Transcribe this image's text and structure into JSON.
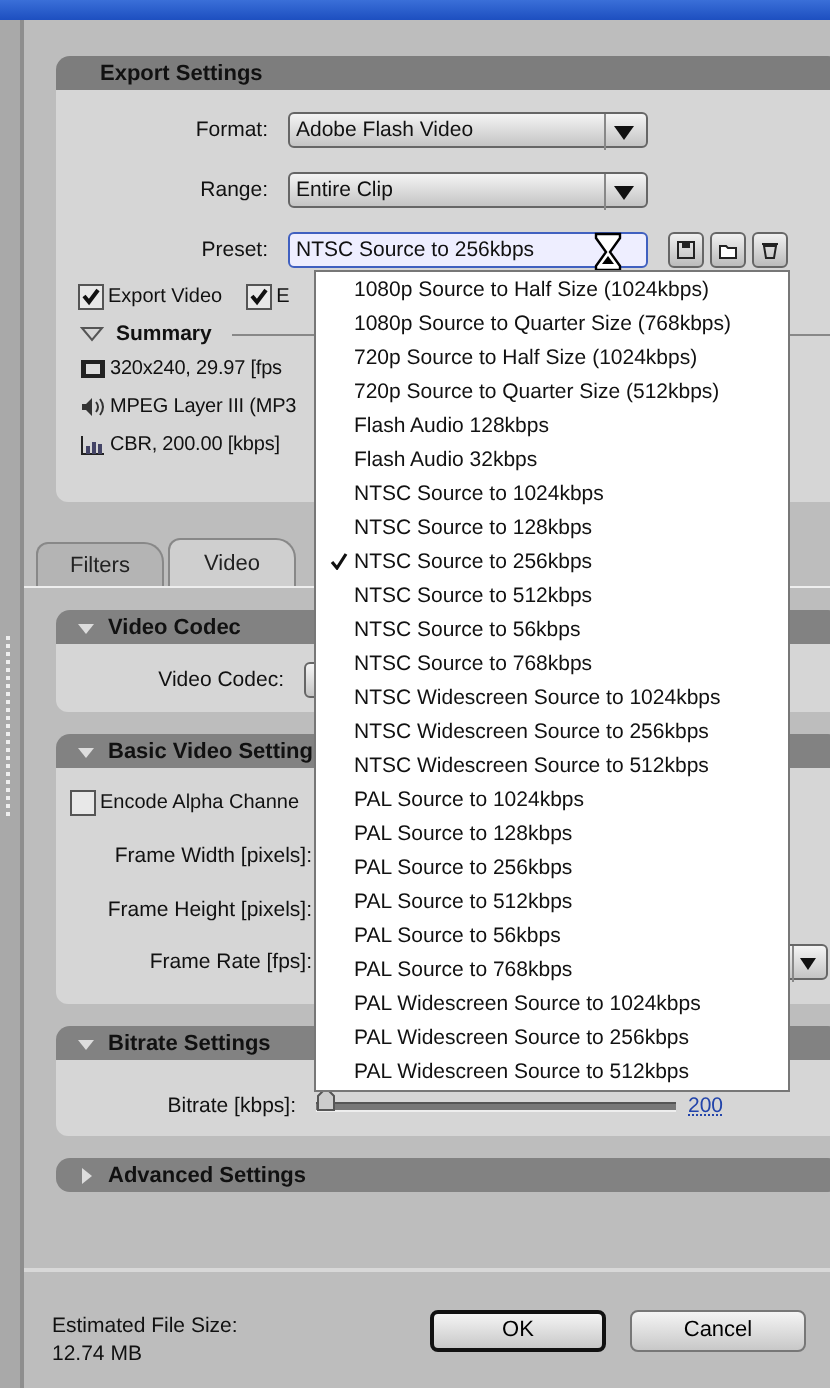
{
  "export_settings": {
    "title": "Export Settings",
    "fields": [
      {
        "label": "Format:",
        "value": "Adobe Flash Video",
        "kind": "dropdown"
      },
      {
        "label": "Range:",
        "value": "Entire Clip",
        "kind": "dropdown"
      },
      {
        "label": "Preset:",
        "value": "NTSC Source to 256kbps",
        "kind": "preset"
      }
    ],
    "checkboxes": [
      {
        "label": "Export Video",
        "checked": true
      },
      {
        "label": "E",
        "checked": true
      }
    ],
    "summary": {
      "title": "Summary",
      "expanded": true,
      "lines": [
        {
          "kind": "video",
          "text": "320x240, 29.97 [fps"
        },
        {
          "kind": "audio",
          "text": "MPEG Layer III (MP3"
        },
        {
          "kind": "bitrate",
          "text": "CBR, 200.00 [kbps]"
        }
      ]
    }
  },
  "tabs": [
    {
      "label": "Filters",
      "selected": false
    },
    {
      "label": "Video",
      "selected": true
    }
  ],
  "video_codec": {
    "title": "Video Codec",
    "expanded": true,
    "label": "Video Codec:"
  },
  "basic_video": {
    "title": "Basic Video Setting",
    "expanded": true,
    "alpha": {
      "label": "Encode Alpha Channe",
      "checked": false
    },
    "frame_width": "Frame Width [pixels]:",
    "frame_height": "Frame Height [pixels]:",
    "frame_rate": "Frame Rate [fps]:"
  },
  "bitrate": {
    "title": "Bitrate Settings",
    "expanded": true,
    "label": "Bitrate [kbps]:",
    "level": 0,
    "reading": "200"
  },
  "advanced": {
    "title": "Advanced Settings",
    "expanded": false
  },
  "preset_menu": {
    "items": [
      {
        "label": "1080p Source to Half Size (1024kbps)",
        "selected": false
      },
      {
        "label": "1080p Source to Quarter Size (768kbps)",
        "selected": false
      },
      {
        "label": "720p Source to Half Size (1024kbps)",
        "selected": false
      },
      {
        "label": "720p Source to Quarter Size (512kbps)",
        "selected": false
      },
      {
        "label": "Flash Audio 128kbps",
        "selected": false
      },
      {
        "label": "Flash Audio 32kbps",
        "selected": false
      },
      {
        "label": "NTSC Source to 1024kbps",
        "selected": false
      },
      {
        "label": "NTSC Source to 128kbps",
        "selected": false
      },
      {
        "label": "NTSC Source to 256kbps",
        "selected": true
      },
      {
        "label": "NTSC Source to 512kbps",
        "selected": false
      },
      {
        "label": "NTSC Source to 56kbps",
        "selected": false
      },
      {
        "label": "NTSC Source to 768kbps",
        "selected": false
      },
      {
        "label": "NTSC Widescreen Source to 1024kbps",
        "selected": false
      },
      {
        "label": "NTSC Widescreen Source to 256kbps",
        "selected": false
      },
      {
        "label": "NTSC Widescreen Source to 512kbps",
        "selected": false
      },
      {
        "label": "PAL Source to 1024kbps",
        "selected": false
      },
      {
        "label": "PAL Source to 128kbps",
        "selected": false
      },
      {
        "label": "PAL Source to 256kbps",
        "selected": false
      },
      {
        "label": "PAL Source to 512kbps",
        "selected": false
      },
      {
        "label": "PAL Source to 56kbps",
        "selected": false
      },
      {
        "label": "PAL Source to 768kbps",
        "selected": false
      },
      {
        "label": "PAL Widescreen Source to 1024kbps",
        "selected": false
      },
      {
        "label": "PAL Widescreen Source to 256kbps",
        "selected": false
      },
      {
        "label": "PAL Widescreen Source to 512kbps",
        "selected": false
      }
    ]
  },
  "footer": {
    "estimate_label": "Estimated File Size:",
    "estimate_value": "12.74 MB",
    "buttons": [
      "OK",
      "Cancel"
    ]
  }
}
